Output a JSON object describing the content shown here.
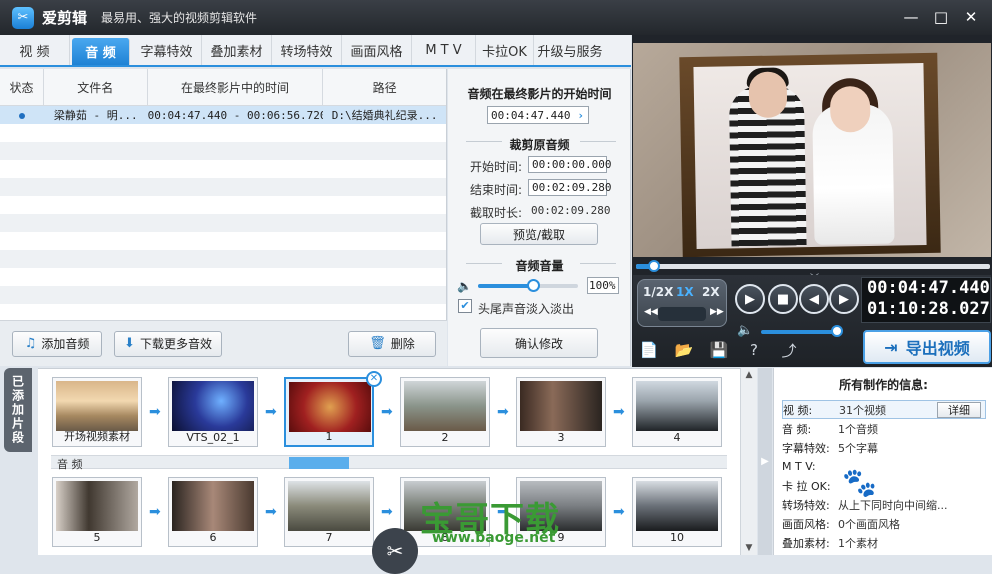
{
  "app": {
    "name": "爱剪辑",
    "slogan": "最易用、强大的视频剪辑软件"
  },
  "window_controls": [
    "minimize",
    "maximize",
    "close"
  ],
  "tabs": [
    {
      "label": "视  频",
      "key": "video",
      "active": false
    },
    {
      "label": "音  频",
      "key": "audio",
      "active": true
    },
    {
      "label": "字幕特效",
      "key": "sub",
      "active": false
    },
    {
      "label": "叠加素材",
      "key": "overlay",
      "active": false
    },
    {
      "label": "转场特效",
      "key": "trans",
      "active": false
    },
    {
      "label": "画面风格",
      "key": "style",
      "active": false
    },
    {
      "label": "M T V",
      "key": "mtv",
      "active": false
    },
    {
      "label": "卡拉OK",
      "key": "karaoke",
      "active": false
    },
    {
      "label": "升级与服务",
      "key": "upgrade",
      "active": false
    }
  ],
  "audio_table": {
    "columns": [
      "状态",
      "文件名",
      "在最终影片中的时间",
      "路径"
    ],
    "rows": [
      {
        "status": "●",
        "filename": "梁静茹 - 明...",
        "time": "00:04:47.440 - 00:06:56.720",
        "path": "D:\\结婚典礼纪录..."
      }
    ]
  },
  "left_buttons": {
    "add_audio": "添加音频",
    "download_more": "下载更多音效",
    "delete": "删除"
  },
  "audio_settings": {
    "start_in_film_label": "音频在最终影片的开始时间",
    "start_in_film_value": "00:04:47.440",
    "trim_label": "裁剪原音频",
    "start_time_label": "开始时间:",
    "start_time_value": "00:00:00.000",
    "end_time_label": "结束时间:",
    "end_time_value": "00:02:09.280",
    "duration_label": "截取时长:",
    "duration_value": "00:02:09.280",
    "preview_btn": "预览/截取",
    "volume_label": "音频音量",
    "volume_value": "100%",
    "volume_level": 0.55,
    "fade_label": "头尾声音淡入淡出",
    "fade_checked": true,
    "confirm_btn": "确认修改"
  },
  "player": {
    "progress": 0.05,
    "speeds": [
      "1/2X",
      "1X",
      "2X"
    ],
    "current_time": "00:04:47.440",
    "total_time": "01:10:28.027",
    "volume_level": 0.9,
    "export_label": "导出视频"
  },
  "timeline": {
    "side_tab": "已添加片段",
    "audio_track_label": "音 频",
    "row1": [
      {
        "label": "开场视频素材"
      },
      {
        "label": "VTS_02_1"
      },
      {
        "label": "1",
        "selected": true
      },
      {
        "label": "2"
      },
      {
        "label": "3"
      },
      {
        "label": "4"
      }
    ],
    "row2": [
      {
        "label": "5"
      },
      {
        "label": "6"
      },
      {
        "label": "7"
      },
      {
        "label": "8"
      },
      {
        "label": "9"
      },
      {
        "label": "10"
      }
    ]
  },
  "info": {
    "title": "所有制作的信息:",
    "rows": [
      {
        "key": "视    频:",
        "value": "31个视频",
        "highlight": true
      },
      {
        "key": "音    频:",
        "value": "1个音频"
      },
      {
        "key": "字幕特效:",
        "value": "5个字幕"
      },
      {
        "key": "M  T  V:",
        "value": ""
      },
      {
        "key": "卡 拉 OK:",
        "value": ""
      },
      {
        "key": "转场特效:",
        "value": "从上下同时向中间缩..."
      },
      {
        "key": "画面风格:",
        "value": "0个画面风格"
      },
      {
        "key": "叠加素材:",
        "value": "1个素材"
      }
    ],
    "detail_btn": "详细"
  },
  "watermark": {
    "text": "宝哥下载",
    "url": "www.baoge.net"
  }
}
